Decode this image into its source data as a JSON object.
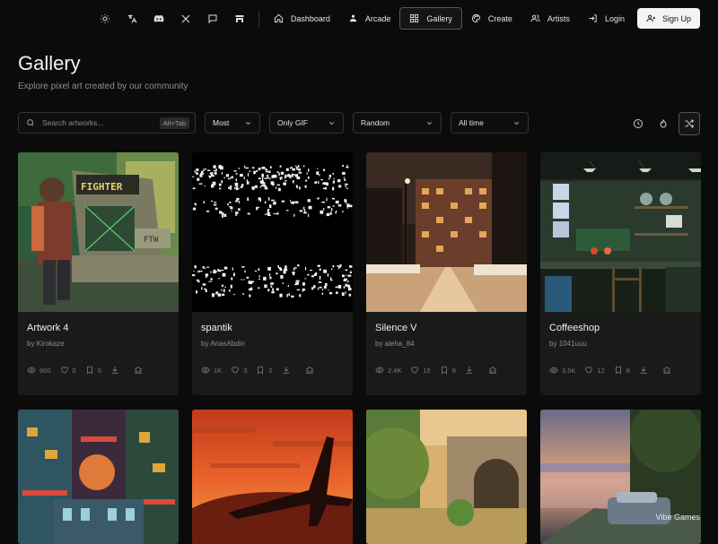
{
  "nav": {
    "links": [
      {
        "label": "Dashboard",
        "icon": "home-icon"
      },
      {
        "label": "Arcade",
        "icon": "gamepad-icon"
      },
      {
        "label": "Gallery",
        "icon": "grid-icon",
        "active": true
      },
      {
        "label": "Create",
        "icon": "palette-icon"
      },
      {
        "label": "Artists",
        "icon": "users-icon"
      },
      {
        "label": "Login",
        "icon": "login-icon"
      }
    ],
    "signup_label": "Sign Up",
    "icons": [
      "sun-icon",
      "translate-icon",
      "discord-icon",
      "x-icon",
      "chat-icon",
      "store-icon"
    ]
  },
  "page": {
    "title": "Gallery",
    "subtitle": "Explore pixel art created by our community"
  },
  "filters": {
    "search_placeholder": "Search artworks...",
    "search_shortcut": "Alt+Tab",
    "sort": "Most",
    "format": "Only GIF",
    "order": "Random",
    "time": "All time"
  },
  "tools": [
    "clock-icon",
    "flame-icon",
    "shuffle-icon"
  ],
  "artworks": [
    {
      "title": "Artwork 4",
      "author": "by Kirokaze",
      "views": "600",
      "likes": "0",
      "saves": "0"
    },
    {
      "title": "spantik",
      "author": "by AnasAbdin",
      "views": "1K",
      "likes": "3",
      "saves": "2"
    },
    {
      "title": "Silence V",
      "author": "by aleha_84",
      "views": "2.4K",
      "likes": "15",
      "saves": "9"
    },
    {
      "title": "Coffeeshop",
      "author": "by 1041uuu",
      "views": "3.5K",
      "likes": "12",
      "saves": "8"
    }
  ],
  "watermark": "Vibe Games",
  "thumb_text": {
    "fighter": "FIGHTER",
    "ftw": "FTW"
  },
  "colors": {
    "accent": "#f4f4f4",
    "background": "#0b0b0b",
    "card": "#1a1a1a"
  }
}
